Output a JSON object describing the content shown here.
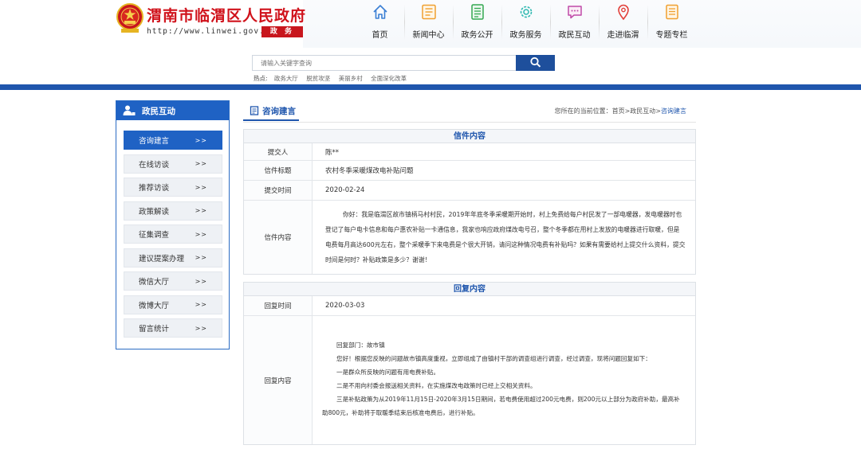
{
  "header": {
    "site_name": "渭南市临渭区人民政府",
    "url": "http://www.linwei.gov.cn",
    "badge": "政 务",
    "emblem_icon": "national-emblem-icon",
    "brand_red": "#d0121b"
  },
  "nav": [
    {
      "label": "首页",
      "icon": "home-icon"
    },
    {
      "label": "新闻中心",
      "icon": "news-icon"
    },
    {
      "label": "政务公开",
      "icon": "document-icon"
    },
    {
      "label": "政务服务",
      "icon": "gear-icon"
    },
    {
      "label": "政民互动",
      "icon": "chat-icon"
    },
    {
      "label": "走进临渭",
      "icon": "location-pin-icon"
    },
    {
      "label": "专题专栏",
      "icon": "list-icon"
    }
  ],
  "search": {
    "placeholder": "请输入关键字查询",
    "hot_label": "热点:",
    "hot_links": [
      "政务大厅",
      "脱贫攻坚",
      "美丽乡村",
      "全面深化改革"
    ]
  },
  "sidebar": {
    "title": "政民互动",
    "items": [
      {
        "label": "咨询建言",
        "arrow": ">>",
        "active": true
      },
      {
        "label": "在线访谈",
        "arrow": ">>"
      },
      {
        "label": "推荐访谈",
        "arrow": ">>"
      },
      {
        "label": "政策解读",
        "arrow": ">>"
      },
      {
        "label": "征集调查",
        "arrow": ">>"
      },
      {
        "label": "建议提案办理",
        "arrow": ">>"
      },
      {
        "label": "微信大厅",
        "arrow": ">>"
      },
      {
        "label": "微博大厅",
        "arrow": ">>"
      },
      {
        "label": "留言统计",
        "arrow": ">>"
      }
    ]
  },
  "main": {
    "tab_title": "咨询建言",
    "breadcrumb_prefix": "您所在的当前位置：首页>政民互动>",
    "breadcrumb_current": "咨询建言"
  },
  "letter": {
    "section_title": "信件内容",
    "submitter_label": "提交人",
    "submitter": "陈**",
    "subject_label": "信件标题",
    "subject": "农村冬季采暖煤改电补贴问题",
    "date_label": "提交时间",
    "date": "2020-02-24",
    "content_label": "信件内容",
    "content": "你好：我是临渭区故市镇柄马村村民，2019年年底冬季采暖期开始时，村上免费给每户村民发了一部电暖器，发电暖器时也登记了每户电卡信息和每户惠农补贴一卡通信息，我家也响应政府煤改电号召，整个冬季都在用村上发放的电暖器进行取暖，但是电费每月高达600元左右，整个采暖季下来电费是个很大开销，请问这种情况电费有补贴吗？如果有需要给村上提交什么资料，提交时间是何时？补贴政策是多少？谢谢！"
  },
  "reply": {
    "section_title": "回复内容",
    "date_label": "回复时间",
    "date": "2020-03-03",
    "content_label": "回复内容",
    "department": "回复部门：故市镇",
    "paragraphs": [
      "您好！根据您反映的问题故市镇高度重视，立即组成了由镇村干部的调查组进行调查，经过调查，现将问题回复如下：",
      "一是群众所反映的问题有用电费补贴。",
      "二是不用向村委会报送相关资料，在实施煤改电政策时已经上交相关资料。",
      "三是补贴政策为从2019年11月15日-2020年3月15日期间，若电费使用超过200元电费，则200元以上部分为政府补助，最高补助800元，补助将于取暖季结束后核准电费后，进行补贴。"
    ]
  }
}
